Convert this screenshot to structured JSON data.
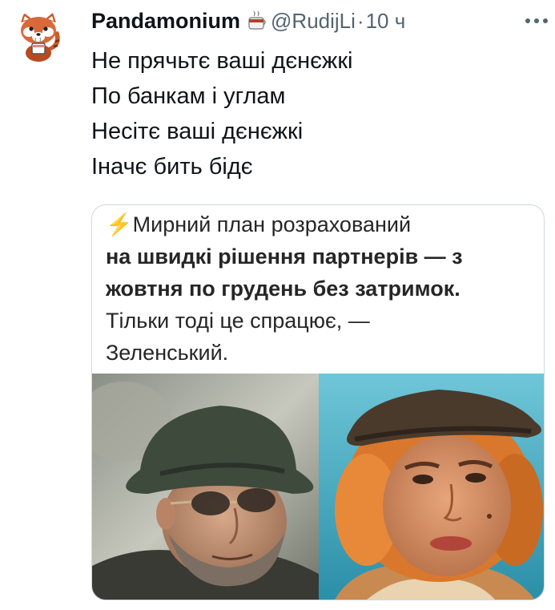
{
  "author": {
    "display_name": "Pandamonium",
    "handle": "@RudijLi",
    "separator": "·",
    "time": "10 ч"
  },
  "tweet": {
    "lines": [
      "Не прячьтє ваші дєнєжкі",
      "По банкам і углам",
      "Несітє ваші дєнєжкі",
      "Іначє бить бідє"
    ]
  },
  "card": {
    "headline_lines": [
      {
        "icon": "⚡",
        "text": "Мирний план розрахований"
      },
      {
        "text": "на швидкі рішення партнерів — з"
      },
      {
        "text": "жовтня по грудень без затримок."
      },
      {
        "text": "Тільки тоді це спрацює, —"
      },
      {
        "text": "Зеленський."
      }
    ]
  },
  "icons": {
    "avatar": "red-panda-avatar-icon",
    "badge": "coffee-cup-icon",
    "more": "more-dots-icon",
    "headline_prefix": "lightning-icon"
  },
  "colors": {
    "text": "#0f1419",
    "secondary": "#536471",
    "border": "#cfd9de"
  }
}
